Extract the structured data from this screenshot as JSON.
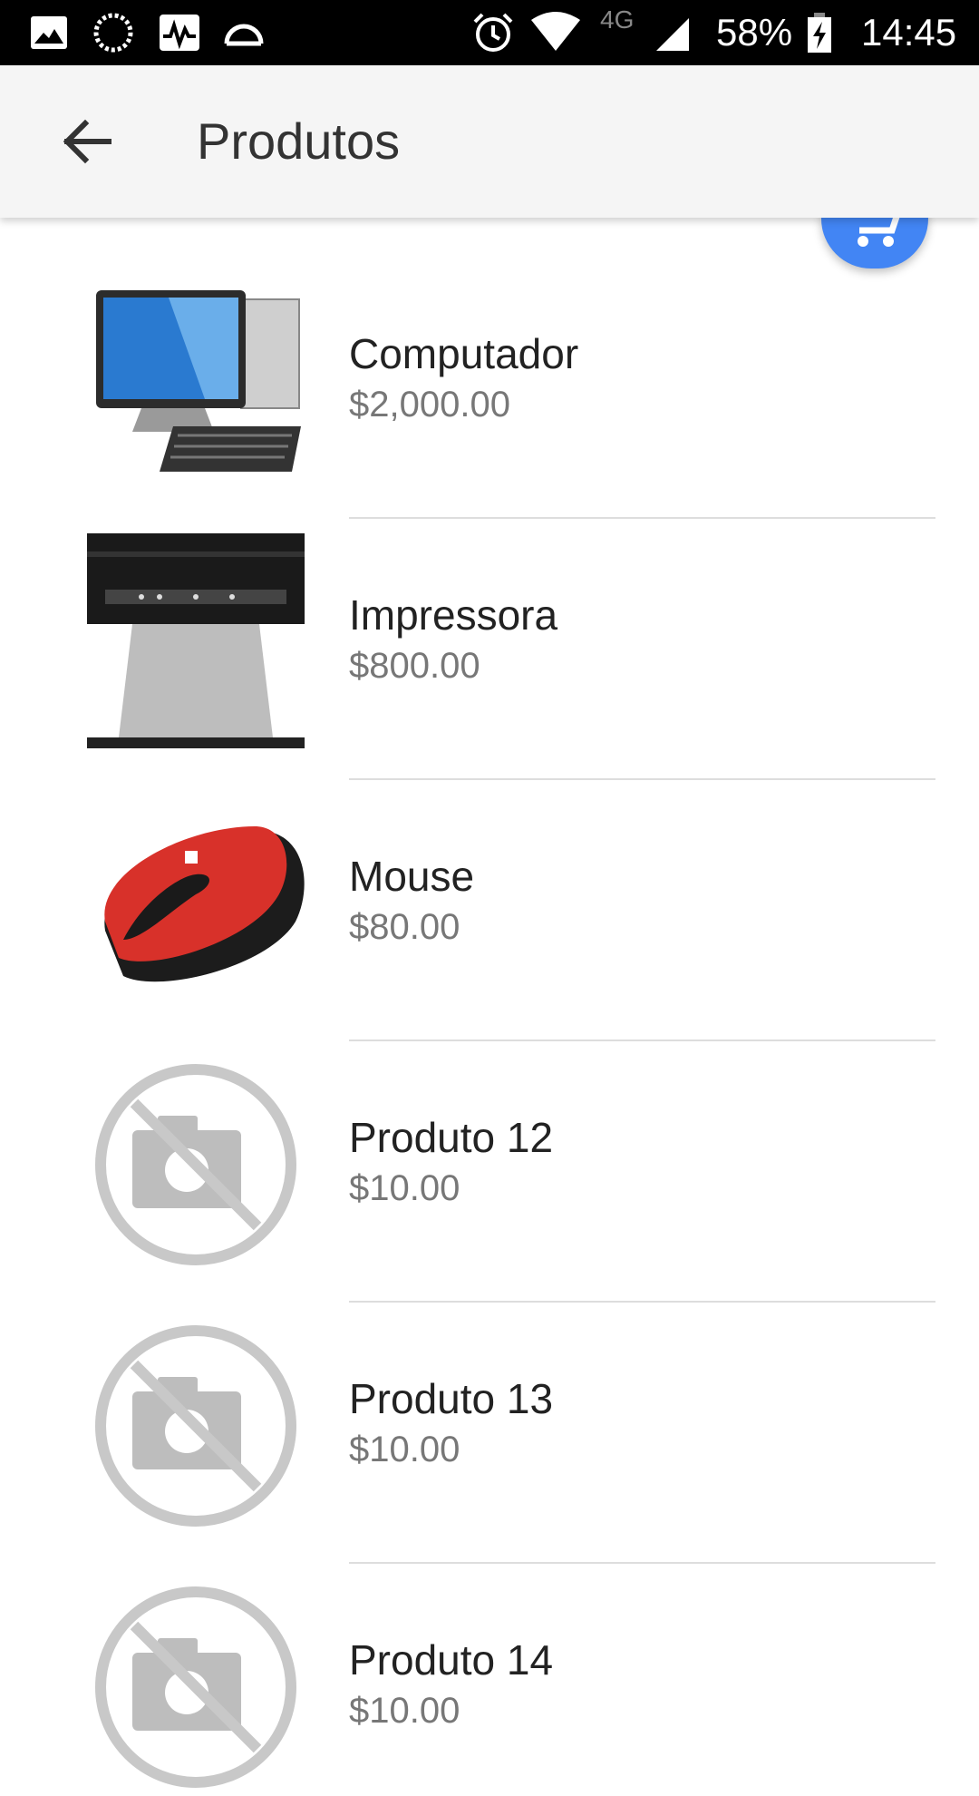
{
  "status_bar": {
    "battery": "58%",
    "network": "4G",
    "time": "14:45"
  },
  "app_bar": {
    "title": "Produtos"
  },
  "colors": {
    "accent": "#4285f4",
    "appbar_bg": "#f5f5f5"
  },
  "products": [
    {
      "name": "Computador",
      "price": "$2,000.00",
      "image": "computer"
    },
    {
      "name": "Impressora",
      "price": "$800.00",
      "image": "printer"
    },
    {
      "name": "Mouse",
      "price": "$80.00",
      "image": "mouse"
    },
    {
      "name": "Produto 12",
      "price": "$10.00",
      "image": "no-photo"
    },
    {
      "name": "Produto 13",
      "price": "$10.00",
      "image": "no-photo"
    },
    {
      "name": "Produto 14",
      "price": "$10.00",
      "image": "no-photo"
    }
  ]
}
